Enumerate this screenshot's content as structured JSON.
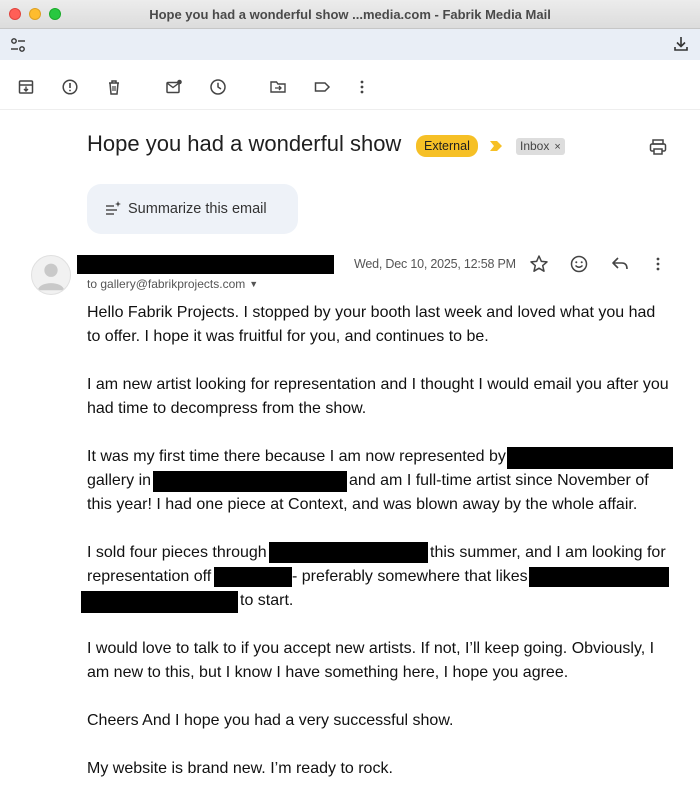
{
  "window": {
    "title": "Hope you had a wonderful show ...media.com - Fabrik Media Mail"
  },
  "toolbar": {
    "icons": [
      "archive-icon",
      "report-spam-icon",
      "delete-icon",
      "mark-unread-icon",
      "snooze-icon",
      "move-to-icon",
      "label-icon",
      "more-vert-icon"
    ]
  },
  "message": {
    "subject": "Hope you had a wonderful show",
    "external_badge": "External",
    "label": "Inbox",
    "label_remove": "×",
    "summarize_label": "Summarize this email",
    "to_line": "to gallery@fabrikprojects.com",
    "date": "Wed, Dec 10, 2025, 12:58 PM",
    "body": {
      "l1": "Hello Fabrik Projects. I stopped by your booth last week and loved what you had",
      "l2": "to offer. I hope it was fruitful for you, and continues to be.",
      "l3": "I am new artist looking for representation and I thought I would email you after you",
      "l4": "had time to decompress from the show.",
      "l5": "It was my first time there because I am now represented by",
      "l6a": "gallery in",
      "l6b": "and am I full-time artist since November of",
      "l7": "this year!  I had one piece at Context, and was blown away by the whole affair.",
      "l8a": "I sold four pieces through",
      "l8b": "this summer, and I am looking for",
      "l9a": "representation off",
      "l9b": "- preferably somewhere that likes",
      "l10": "to start.",
      "l11": "I would love to talk to if you accept new artists. If not, I’ll keep going. Obviously, I",
      "l12": "am new to this, but I know I have something here, I hope you agree.",
      "l13": "Cheers And I hope you had a very successful show.",
      "l14": "My website is brand new. I’m ready to rock."
    }
  },
  "colors": {
    "external_badge": "#f6c026",
    "important_marker": "#f6c026",
    "summarize_bg": "#eef2f8"
  }
}
